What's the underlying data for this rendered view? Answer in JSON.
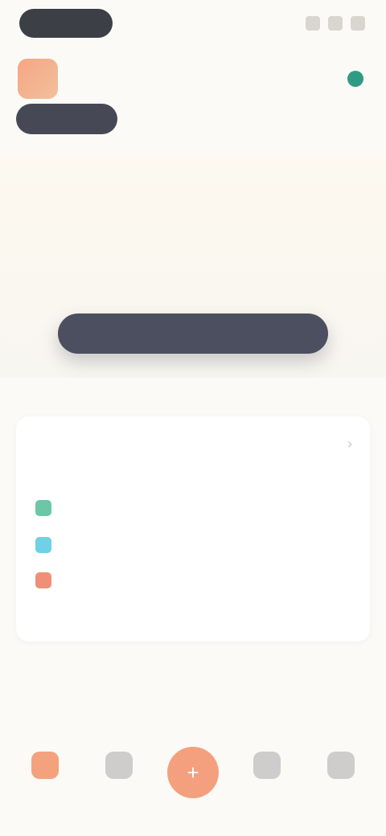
{
  "top": {
    "pill_label": "",
    "right_icons": [
      "icon-a",
      "icon-b",
      "icon-c"
    ]
  },
  "header": {
    "brand": "",
    "status": ""
  },
  "tabs": [
    {
      "label": "",
      "active": true
    },
    {
      "label": ""
    },
    {
      "label": ""
    },
    {
      "label": ""
    }
  ],
  "hero": {
    "title_main": "",
    "title_accent": "",
    "subtitle": "",
    "cta": ""
  },
  "section": {
    "title": "",
    "link": ""
  },
  "card": {
    "title": "",
    "sub_bold": "",
    "sub_rest": "",
    "rows": [
      {
        "label": "",
        "value": "",
        "color": "#6cc7a7"
      },
      {
        "label": "",
        "value": "",
        "color": "#6fd0e6"
      },
      {
        "label": "",
        "value": "",
        "color": "#f08f78"
      }
    ],
    "link": ""
  },
  "article": {
    "title": "",
    "body": ""
  },
  "nav": [
    {
      "label": "",
      "icon": "home-icon",
      "active": true
    },
    {
      "label": "",
      "icon": "grid-icon"
    },
    {
      "label": "",
      "icon": "plus-icon",
      "center": true
    },
    {
      "label": "",
      "icon": "chat-icon"
    },
    {
      "label": "",
      "icon": "user-icon"
    }
  ]
}
